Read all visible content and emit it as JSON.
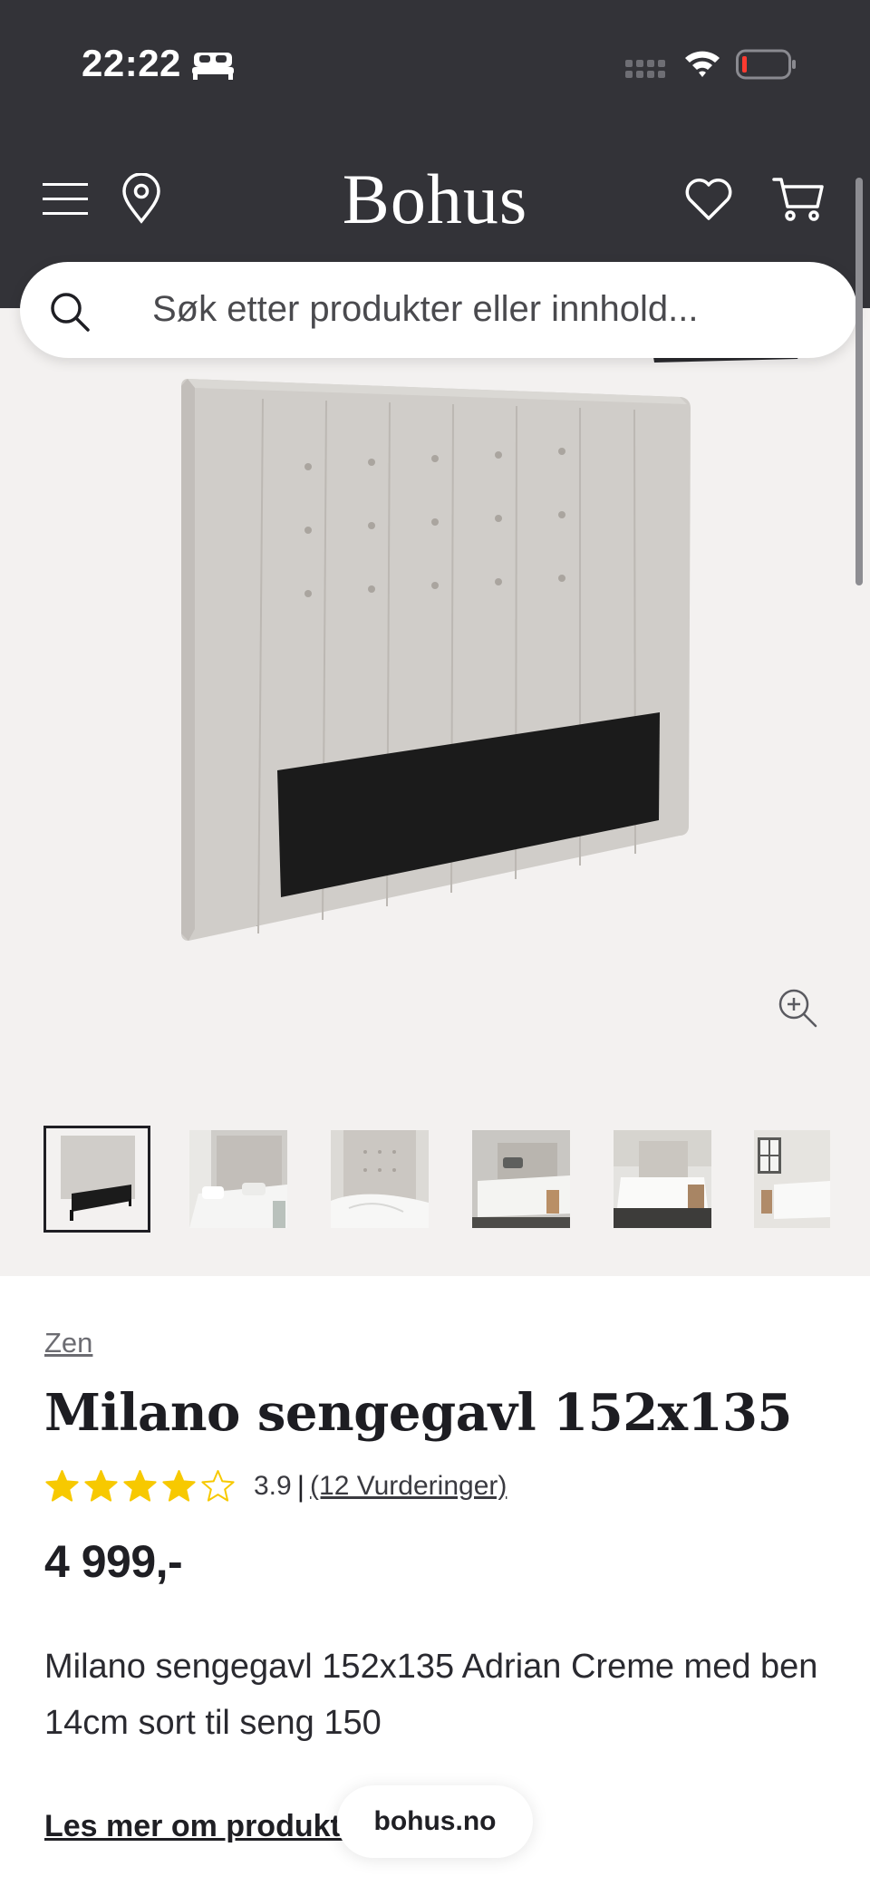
{
  "status_bar": {
    "time": "22:22"
  },
  "header": {
    "logo": "Bohus",
    "search": {
      "placeholder": "Søk etter produkter eller innhold..."
    }
  },
  "gallery": {
    "images": [
      {
        "type": "headboard"
      },
      {
        "type": "bedroom"
      },
      {
        "type": "bed-closeup"
      },
      {
        "type": "bedroom-wide"
      },
      {
        "type": "bedroom-bright"
      },
      {
        "type": "bedroom-window"
      }
    ],
    "active_index": 0
  },
  "product": {
    "brand": "Zen",
    "title": "Milano sengegavl 152x135",
    "rating": {
      "value": "3.9",
      "separator": "|",
      "reviews": "(12 Vurderinger)",
      "stars": 3.9,
      "max": 5
    },
    "price": "4 999,-",
    "description": "Milano sengegavl 152x135 Adrian Creme med ben 14cm sort til seng 150",
    "read_more": "Les mer om produktet"
  },
  "domain_pill": "bohus.no",
  "colors": {
    "header_bg": "#333338",
    "gallery_bg": "#f3f1f0",
    "star": "#f7c900",
    "text": "#1f1f24"
  }
}
